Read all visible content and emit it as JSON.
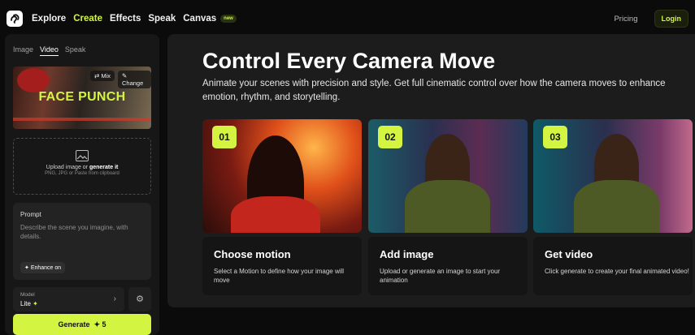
{
  "nav": {
    "explore": "Explore",
    "create": "Create",
    "effects": "Effects",
    "speak": "Speak",
    "canvas": "Canvas",
    "canvas_badge": "new"
  },
  "header": {
    "pricing": "Pricing",
    "login": "Login"
  },
  "left_panel": {
    "tabs": [
      "Image",
      "Video",
      "Speak"
    ],
    "active_tab": "Video",
    "preview": {
      "title": "FACE PUNCH",
      "mix_label": "Mix",
      "change_label": "Change"
    },
    "upload": {
      "line1_prefix": "Upload image or ",
      "line1_link": "generate it",
      "line2": "PNG, JPG or Paste from clipboard"
    },
    "prompt": {
      "label": "Prompt",
      "placeholder": "Describe the scene you imagine, with details.",
      "enhance": "Enhance on"
    },
    "model": {
      "label": "Model",
      "value": "Lite"
    },
    "generate": {
      "label": "Generate",
      "credits": "5"
    }
  },
  "main": {
    "headline": "Control Every Camera Move",
    "subtitle": "Animate your scenes with precision and style. Get full cinematic control over how the camera moves to enhance emotion, rhythm, and storytelling.",
    "steps": [
      {
        "num": "01",
        "title": "Choose motion",
        "desc": "Select a Motion to define how your image will move"
      },
      {
        "num": "02",
        "title": "Add image",
        "desc": "Upload or generate an image to start your animation"
      },
      {
        "num": "03",
        "title": "Get video",
        "desc": "Click generate to create your final animated video!"
      }
    ]
  },
  "colors": {
    "accent": "#d3f541",
    "background": "#0b0b0b",
    "panel": "#1c1c1c"
  }
}
